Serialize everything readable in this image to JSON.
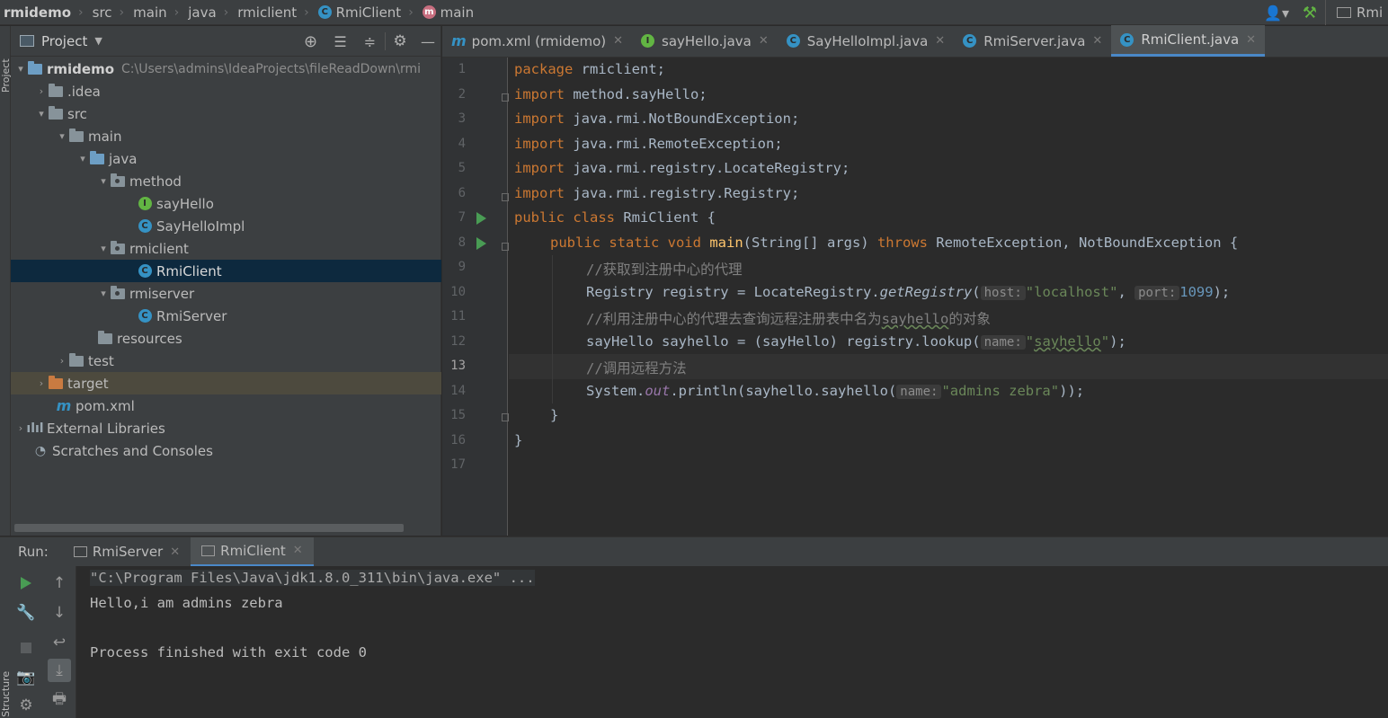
{
  "navbar": {
    "breadcrumbs": [
      "rmidemo",
      "src",
      "main",
      "java",
      "rmiclient",
      "RmiClient",
      "main"
    ],
    "right_label": "Rmi"
  },
  "project": {
    "title": "Project",
    "tree": [
      {
        "label": "rmidemo",
        "path": "C:\\Users\\admins\\IdeaProjects\\fileReadDown\\rmi",
        "icon": "module-folder-icon",
        "arrow": "▾"
      },
      {
        "label": ".idea",
        "icon": "folder-icon",
        "arrow": "›"
      },
      {
        "label": "src",
        "icon": "folder-icon",
        "arrow": "▾"
      },
      {
        "label": "main",
        "icon": "folder-icon",
        "arrow": "▾"
      },
      {
        "label": "java",
        "icon": "source-folder-icon",
        "arrow": "▾"
      },
      {
        "label": "method",
        "icon": "package-icon",
        "arrow": "▾"
      },
      {
        "label": "sayHello",
        "icon": "interface-icon"
      },
      {
        "label": "SayHelloImpl",
        "icon": "class-icon"
      },
      {
        "label": "rmiclient",
        "icon": "package-icon",
        "arrow": "▾"
      },
      {
        "label": "RmiClient",
        "icon": "class-icon"
      },
      {
        "label": "rmiserver",
        "icon": "package-icon",
        "arrow": "▾"
      },
      {
        "label": "RmiServer",
        "icon": "class-icon"
      },
      {
        "label": "resources",
        "icon": "resources-folder-icon"
      },
      {
        "label": "test",
        "icon": "folder-icon",
        "arrow": "›"
      },
      {
        "label": "target",
        "icon": "excluded-folder-icon",
        "arrow": "›"
      },
      {
        "label": "pom.xml",
        "icon": "maven-icon"
      },
      {
        "label": "External Libraries",
        "icon": "libraries-icon",
        "arrow": "›"
      },
      {
        "label": "Scratches and Consoles",
        "icon": "scratches-icon"
      }
    ]
  },
  "tabs": [
    {
      "label": "pom.xml (rmidemo)",
      "icon": "maven-icon"
    },
    {
      "label": "sayHello.java",
      "icon": "interface-icon"
    },
    {
      "label": "SayHelloImpl.java",
      "icon": "class-icon"
    },
    {
      "label": "RmiServer.java",
      "icon": "class-icon"
    },
    {
      "label": "RmiClient.java",
      "icon": "class-icon",
      "active": true
    }
  ],
  "editor": {
    "line_numbers": [
      "1",
      "2",
      "3",
      "4",
      "5",
      "6",
      "7",
      "8",
      "9",
      "10",
      "11",
      "12",
      "13",
      "14",
      "15",
      "16",
      "17"
    ],
    "current_line": "13",
    "code": {
      "l1_kw": "package",
      "l1_rest": " rmiclient;",
      "l2_kw": "import",
      "l2_rest": " method.sayHello;",
      "l3_kw": "import",
      "l3_rest": " java.rmi.NotBoundException;",
      "l4_kw": "import",
      "l4_rest": " java.rmi.RemoteException;",
      "l5_kw": "import",
      "l5_rest": " java.rmi.registry.LocateRegistry;",
      "l6_kw": "import",
      "l6_rest": " java.rmi.registry.Registry;",
      "l7_kw": "public class",
      "l7_rest": " RmiClient {",
      "l8_kw1": "public static void",
      "l8_fn": "main",
      "l8_mid": "(String[] args) ",
      "l8_kw2": "throws",
      "l8_rest": " RemoteException, NotBoundException {",
      "l9_cm": "//获取到注册中心的代理",
      "l10_a": "Registry registry = LocateRegistry.",
      "l10_it": "getRegistry",
      "l10_b": "(",
      "l10_hint1": "host:",
      "l10_str": "\"localhost\"",
      "l10_c": ", ",
      "l10_hint2": "port:",
      "l10_num": "1099",
      "l10_d": ");",
      "l11_cm": "//利用注册中心的代理去查询远程注册表中名为",
      "l11_sq": "sayhello",
      "l11_cm2": "的对象",
      "l12_a": "sayHello sayhello = (sayHello) registry.lookup(",
      "l12_hint": "name:",
      "l12_str1": "\"",
      "l12_sq": "sayhello",
      "l12_str2": "\"",
      "l12_b": ");",
      "l13_cm": "//调用远程方法",
      "l14_a": "System.",
      "l14_it": "out",
      "l14_b": ".println(sayhello.sayhello(",
      "l14_hint": "name:",
      "l14_str": "\"admins zebra\"",
      "l14_c": "));",
      "l15": "}",
      "l16": "}"
    }
  },
  "run": {
    "label": "Run:",
    "tabs": [
      "RmiServer",
      "RmiClient"
    ],
    "console": [
      "\"C:\\Program Files\\Java\\jdk1.8.0_311\\bin\\java.exe\" ...",
      "Hello,i am admins zebra",
      "",
      "Process finished with exit code 0"
    ]
  },
  "colors": {
    "keyword": "#cc7832",
    "string": "#6a8759",
    "number": "#6897bb",
    "comment": "#808080",
    "method": "#ffc66d",
    "selection": "#0d293e",
    "accent": "#4a88c7"
  }
}
